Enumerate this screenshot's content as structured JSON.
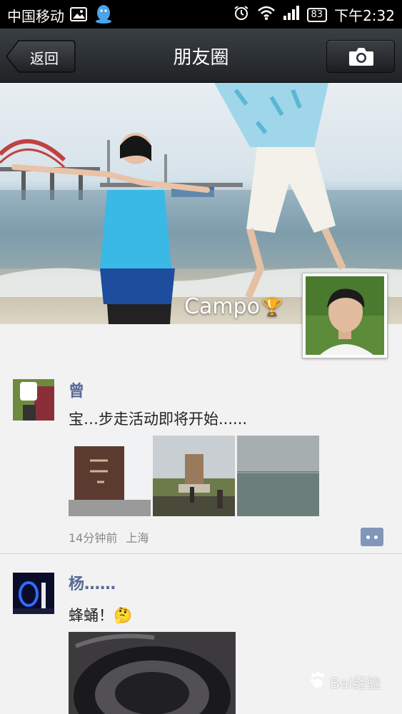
{
  "status_bar": {
    "carrier": "中国移动",
    "battery": "83",
    "time": "下午2:32"
  },
  "nav": {
    "back_label": "返回",
    "title": "朋友圈"
  },
  "cover": {
    "user_name": "Campo"
  },
  "posts": [
    {
      "user": "曾",
      "text": "宝…步走活动即将开始......",
      "time": "14分钟前",
      "location": "上海"
    },
    {
      "user": "杨……",
      "text": "蜂蛹！"
    }
  ],
  "watermark": "Bai经验",
  "colors": {
    "name_link": "#576b95",
    "nav_bg": "#2b2f33",
    "comment_button": "#8297b8"
  },
  "icons": [
    "image-icon",
    "qq-icon",
    "alarm-icon",
    "wifi-icon",
    "signal-icon",
    "camera-icon",
    "trophy-icon",
    "comment-icon",
    "emoji-icon",
    "baidu-paw-icon"
  ]
}
